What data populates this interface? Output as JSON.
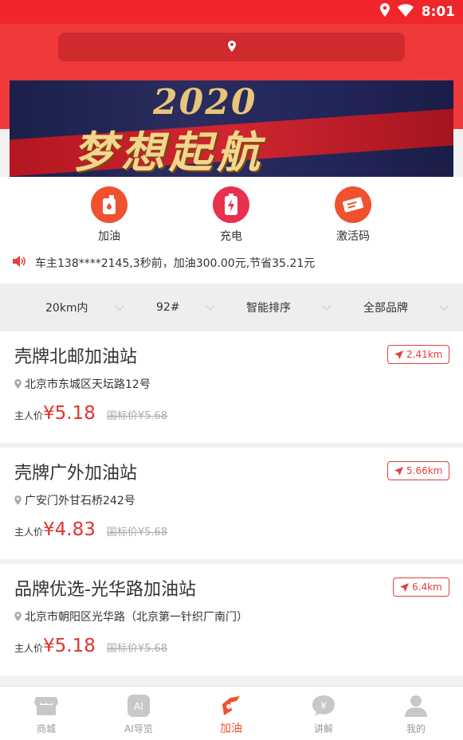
{
  "status_bar": {
    "time": "8:01"
  },
  "search": {
    "placeholder": ""
  },
  "banner": {
    "year": "2020",
    "slogan": "梦想起航"
  },
  "quick_actions": [
    {
      "label": "加油",
      "icon": "fuel-bottle-icon",
      "color": "#f0512f"
    },
    {
      "label": "充电",
      "icon": "battery-charge-icon",
      "color": "#e8304f"
    },
    {
      "label": "激活码",
      "icon": "ticket-icon",
      "color": "#f0512f"
    }
  ],
  "notice": {
    "text": "车主138****2145,3秒前，加油300.00元,节省35.21元"
  },
  "filters": [
    {
      "label": "20km内"
    },
    {
      "label": "92#"
    },
    {
      "label": "智能排序"
    },
    {
      "label": "全部品牌"
    }
  ],
  "stations": [
    {
      "name": "壳牌北邮加油站",
      "distance": "2.41km",
      "address": "北京市东城区天坛路12号",
      "owner_price_label": "主人价",
      "price": "¥5.18",
      "standard_price": "国标价¥5.68"
    },
    {
      "name": "壳牌广外加油站",
      "distance": "5.66km",
      "address": "广安门外甘石桥242号",
      "owner_price_label": "主人价",
      "price": "¥4.83",
      "standard_price": "国标价¥5.68"
    },
    {
      "name": "品牌优选-光华路加油站",
      "distance": "6.4km",
      "address": "北京市朝阳区光华路（北京第一针织厂南门）",
      "owner_price_label": "主人价",
      "price": "¥5.18",
      "standard_price": "国标价¥5.68"
    }
  ],
  "tabs": [
    {
      "label": "商城",
      "icon": "shop-icon",
      "active": false
    },
    {
      "label": "AI导览",
      "icon": "ai-icon",
      "active": false
    },
    {
      "label": "加油",
      "icon": "fuel-nozzle-icon",
      "active": true
    },
    {
      "label": "讲解",
      "icon": "yen-bubble-icon",
      "active": false
    },
    {
      "label": "我的",
      "icon": "user-icon",
      "active": false
    }
  ],
  "colors": {
    "header_red": "#f0393b",
    "price_red": "#e0322e",
    "active_tab": "#f0512f"
  }
}
